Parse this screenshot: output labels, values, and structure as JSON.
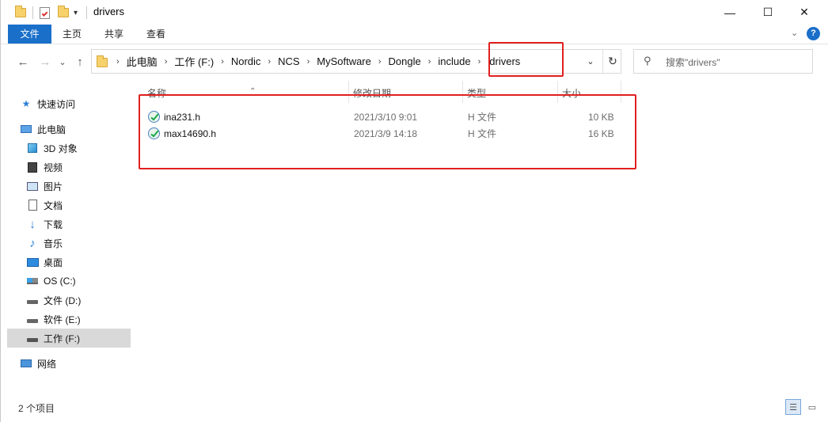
{
  "window": {
    "title": "drivers",
    "controls": {
      "minimize": "—",
      "maximize": "☐",
      "close": "✕"
    }
  },
  "ribbon": {
    "tabs": [
      {
        "label": "文件",
        "active": true
      },
      {
        "label": "主页"
      },
      {
        "label": "共享"
      },
      {
        "label": "查看"
      }
    ],
    "help_icon": "?"
  },
  "nav": {
    "back": "←",
    "forward": "→",
    "recent": "⌄",
    "up": "↑",
    "breadcrumbs": [
      "此电脑",
      "工作 (F:)",
      "Nordic",
      "NCS",
      "MySoftware",
      "Dongle",
      "include",
      "drivers"
    ],
    "search_placeholder": "搜索\"drivers\""
  },
  "sidebar": {
    "items": [
      {
        "label": "快速访问",
        "icon": "star-icon"
      },
      {
        "label": "此电脑",
        "icon": "computer-icon"
      },
      {
        "label": "3D 对象",
        "icon": "cube-icon"
      },
      {
        "label": "视频",
        "icon": "video-icon"
      },
      {
        "label": "图片",
        "icon": "pictures-icon"
      },
      {
        "label": "文档",
        "icon": "document-icon"
      },
      {
        "label": "下载",
        "icon": "download-icon"
      },
      {
        "label": "音乐",
        "icon": "music-icon"
      },
      {
        "label": "桌面",
        "icon": "desktop-icon"
      },
      {
        "label": "OS (C:)",
        "icon": "windows-drive-icon"
      },
      {
        "label": "文件 (D:)",
        "icon": "drive-icon"
      },
      {
        "label": "软件 (E:)",
        "icon": "drive-icon"
      },
      {
        "label": "工作 (F:)",
        "icon": "drive-icon",
        "selected": true
      },
      {
        "label": "网络",
        "icon": "network-icon"
      }
    ]
  },
  "list": {
    "columns": [
      "名称",
      "修改日期",
      "类型",
      "大小"
    ],
    "rows": [
      {
        "name": "ina231.h",
        "modified": "2021/3/10 9:01",
        "type": "H 文件",
        "size": "10 KB"
      },
      {
        "name": "max14690.h",
        "modified": "2021/3/9 14:18",
        "type": "H 文件",
        "size": "16 KB"
      }
    ]
  },
  "status": {
    "count": "2 个项目"
  },
  "colors": {
    "accent": "#1a6fc9",
    "highlight": "#e02020"
  }
}
